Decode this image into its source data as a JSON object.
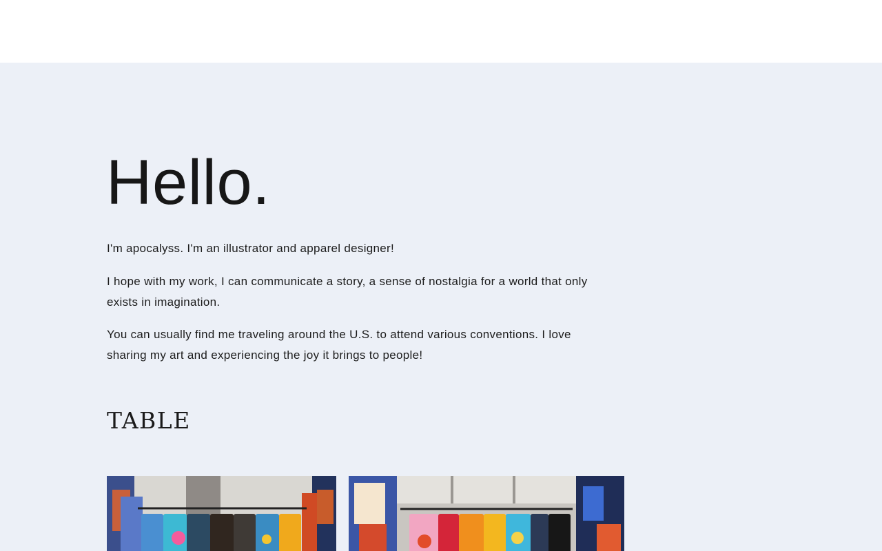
{
  "hero": {
    "heading": "Hello."
  },
  "intro": {
    "paragraphs": [
      "I'm apocalyss. I'm an illustrator and apparel designer!",
      "I hope with my work, I can communicate a story, a sense of nostalgia for a world that only exists in imagination.",
      "You can usually find me traveling around the U.S. to attend various conventions. I love sharing my art and experiencing the joy it brings to people!"
    ]
  },
  "table_section": {
    "heading": "TABLE"
  },
  "colors": {
    "header_bg": "#ffffff",
    "page_bg": "#ecf0f7",
    "text": "#1a1a1a"
  }
}
